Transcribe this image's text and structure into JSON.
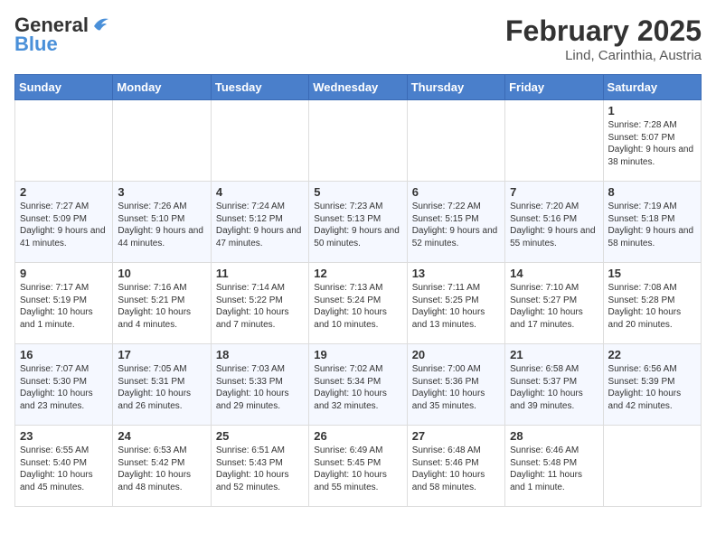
{
  "header": {
    "logo_line1": "General",
    "logo_line2": "Blue",
    "month_title": "February 2025",
    "location": "Lind, Carinthia, Austria"
  },
  "days_of_week": [
    "Sunday",
    "Monday",
    "Tuesday",
    "Wednesday",
    "Thursday",
    "Friday",
    "Saturday"
  ],
  "weeks": [
    [
      {
        "day": "",
        "text": ""
      },
      {
        "day": "",
        "text": ""
      },
      {
        "day": "",
        "text": ""
      },
      {
        "day": "",
        "text": ""
      },
      {
        "day": "",
        "text": ""
      },
      {
        "day": "",
        "text": ""
      },
      {
        "day": "1",
        "text": "Sunrise: 7:28 AM\nSunset: 5:07 PM\nDaylight: 9 hours and 38 minutes."
      }
    ],
    [
      {
        "day": "2",
        "text": "Sunrise: 7:27 AM\nSunset: 5:09 PM\nDaylight: 9 hours and 41 minutes."
      },
      {
        "day": "3",
        "text": "Sunrise: 7:26 AM\nSunset: 5:10 PM\nDaylight: 9 hours and 44 minutes."
      },
      {
        "day": "4",
        "text": "Sunrise: 7:24 AM\nSunset: 5:12 PM\nDaylight: 9 hours and 47 minutes."
      },
      {
        "day": "5",
        "text": "Sunrise: 7:23 AM\nSunset: 5:13 PM\nDaylight: 9 hours and 50 minutes."
      },
      {
        "day": "6",
        "text": "Sunrise: 7:22 AM\nSunset: 5:15 PM\nDaylight: 9 hours and 52 minutes."
      },
      {
        "day": "7",
        "text": "Sunrise: 7:20 AM\nSunset: 5:16 PM\nDaylight: 9 hours and 55 minutes."
      },
      {
        "day": "8",
        "text": "Sunrise: 7:19 AM\nSunset: 5:18 PM\nDaylight: 9 hours and 58 minutes."
      }
    ],
    [
      {
        "day": "9",
        "text": "Sunrise: 7:17 AM\nSunset: 5:19 PM\nDaylight: 10 hours and 1 minute."
      },
      {
        "day": "10",
        "text": "Sunrise: 7:16 AM\nSunset: 5:21 PM\nDaylight: 10 hours and 4 minutes."
      },
      {
        "day": "11",
        "text": "Sunrise: 7:14 AM\nSunset: 5:22 PM\nDaylight: 10 hours and 7 minutes."
      },
      {
        "day": "12",
        "text": "Sunrise: 7:13 AM\nSunset: 5:24 PM\nDaylight: 10 hours and 10 minutes."
      },
      {
        "day": "13",
        "text": "Sunrise: 7:11 AM\nSunset: 5:25 PM\nDaylight: 10 hours and 13 minutes."
      },
      {
        "day": "14",
        "text": "Sunrise: 7:10 AM\nSunset: 5:27 PM\nDaylight: 10 hours and 17 minutes."
      },
      {
        "day": "15",
        "text": "Sunrise: 7:08 AM\nSunset: 5:28 PM\nDaylight: 10 hours and 20 minutes."
      }
    ],
    [
      {
        "day": "16",
        "text": "Sunrise: 7:07 AM\nSunset: 5:30 PM\nDaylight: 10 hours and 23 minutes."
      },
      {
        "day": "17",
        "text": "Sunrise: 7:05 AM\nSunset: 5:31 PM\nDaylight: 10 hours and 26 minutes."
      },
      {
        "day": "18",
        "text": "Sunrise: 7:03 AM\nSunset: 5:33 PM\nDaylight: 10 hours and 29 minutes."
      },
      {
        "day": "19",
        "text": "Sunrise: 7:02 AM\nSunset: 5:34 PM\nDaylight: 10 hours and 32 minutes."
      },
      {
        "day": "20",
        "text": "Sunrise: 7:00 AM\nSunset: 5:36 PM\nDaylight: 10 hours and 35 minutes."
      },
      {
        "day": "21",
        "text": "Sunrise: 6:58 AM\nSunset: 5:37 PM\nDaylight: 10 hours and 39 minutes."
      },
      {
        "day": "22",
        "text": "Sunrise: 6:56 AM\nSunset: 5:39 PM\nDaylight: 10 hours and 42 minutes."
      }
    ],
    [
      {
        "day": "23",
        "text": "Sunrise: 6:55 AM\nSunset: 5:40 PM\nDaylight: 10 hours and 45 minutes."
      },
      {
        "day": "24",
        "text": "Sunrise: 6:53 AM\nSunset: 5:42 PM\nDaylight: 10 hours and 48 minutes."
      },
      {
        "day": "25",
        "text": "Sunrise: 6:51 AM\nSunset: 5:43 PM\nDaylight: 10 hours and 52 minutes."
      },
      {
        "day": "26",
        "text": "Sunrise: 6:49 AM\nSunset: 5:45 PM\nDaylight: 10 hours and 55 minutes."
      },
      {
        "day": "27",
        "text": "Sunrise: 6:48 AM\nSunset: 5:46 PM\nDaylight: 10 hours and 58 minutes."
      },
      {
        "day": "28",
        "text": "Sunrise: 6:46 AM\nSunset: 5:48 PM\nDaylight: 11 hours and 1 minute."
      },
      {
        "day": "",
        "text": ""
      }
    ]
  ]
}
